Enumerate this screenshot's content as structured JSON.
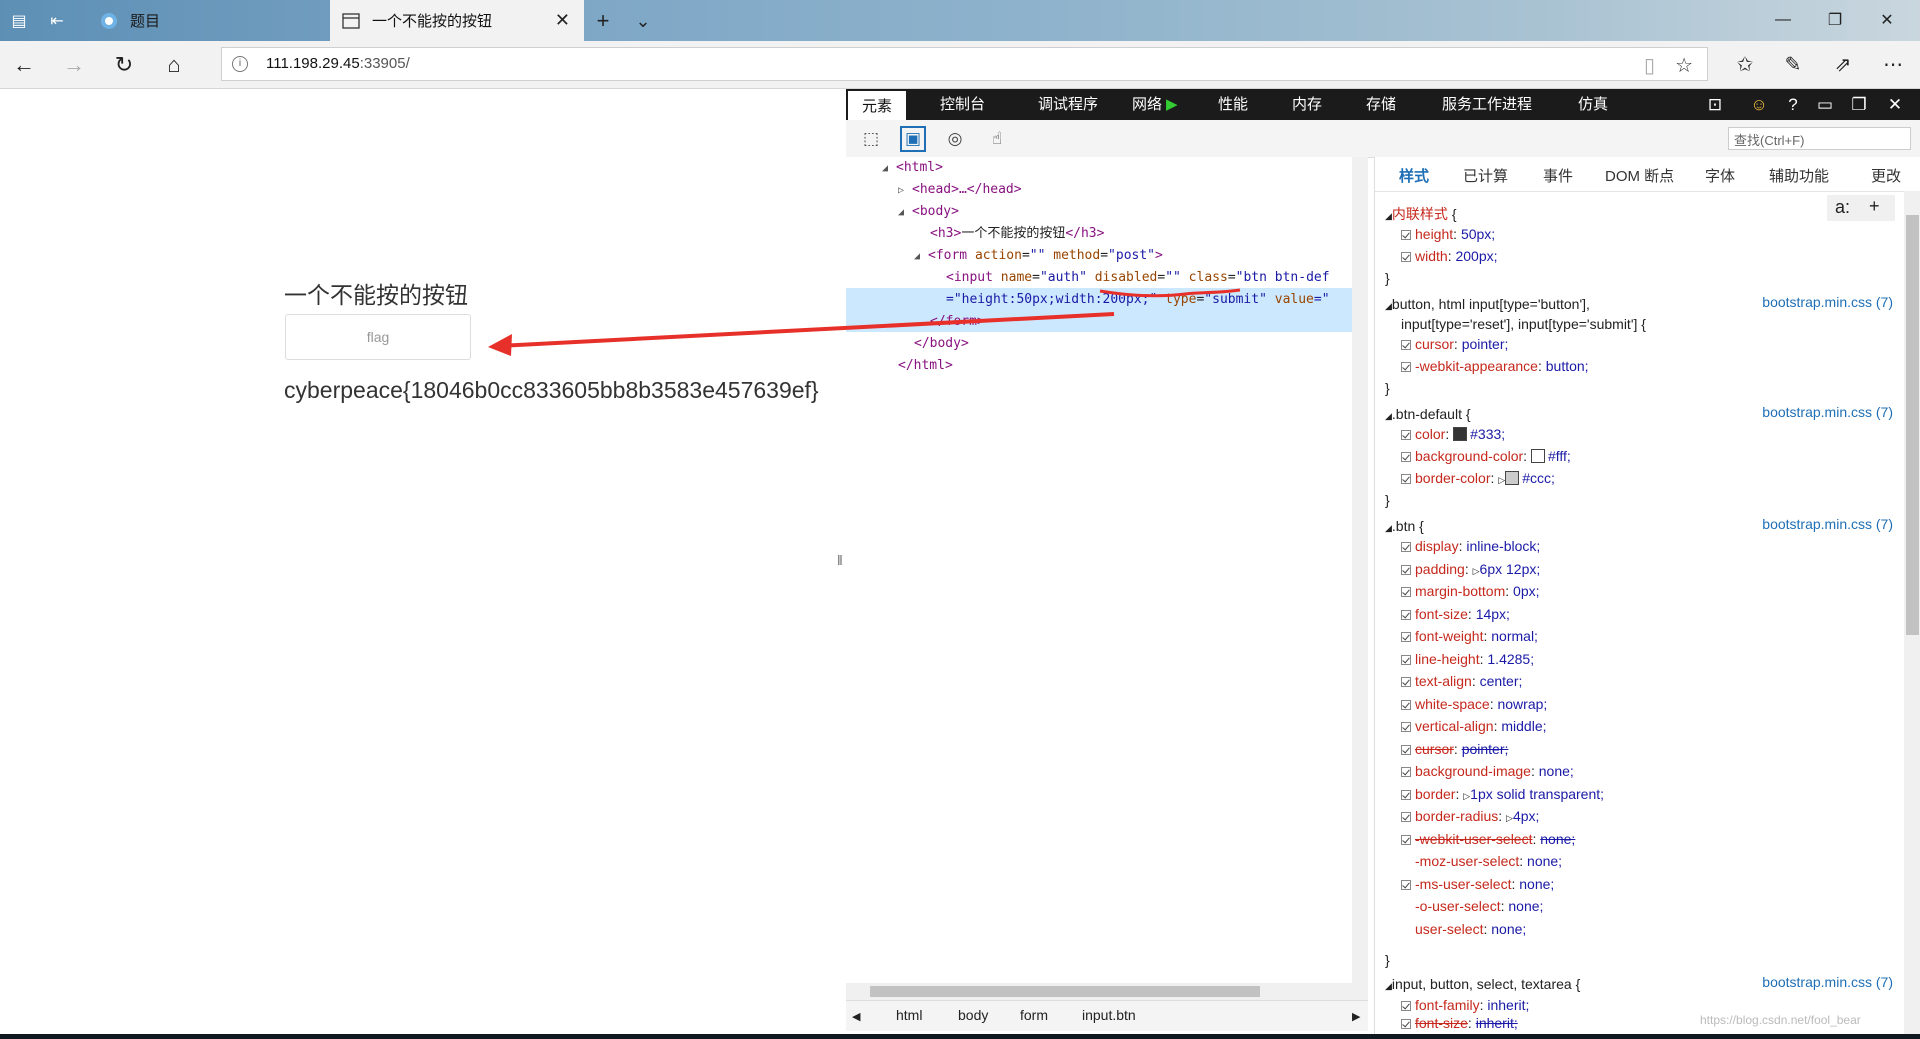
{
  "tabbar": {
    "tabs": [
      {
        "title": "题目",
        "active": false
      },
      {
        "title": "一个不能按的按钮",
        "active": true
      }
    ],
    "new_tab_glyph": "+",
    "tab_list_glyph": "⌄",
    "window_controls": [
      "—",
      "❐",
      "✕"
    ]
  },
  "addressbar": {
    "url_host": "111.198.29.45",
    "url_rest": ":33905/",
    "icons": [
      "back-icon",
      "forward-icon",
      "refresh-icon",
      "home-icon",
      "info-icon",
      "reading-view-icon",
      "favorite-star-icon",
      "favorites-icon",
      "pen-icon",
      "share-icon",
      "more-icon"
    ]
  },
  "page": {
    "heading": "一个不能按的按钮",
    "button_label": "flag",
    "flag_text": "cyberpeace{18046b0cc833605bb8b3583e457639ef}"
  },
  "devtools": {
    "tabs": [
      "元素",
      "控制台",
      "调试程序",
      "网络",
      "性能",
      "内存",
      "存储",
      "服务工作进程",
      "仿真"
    ],
    "find_placeholder": "查找(Ctrl+F)",
    "dom": {
      "html_open": "<html>",
      "head": "<head>…</head>",
      "body_open": "<body>",
      "h3_open": "<h3>",
      "h3_text": "一个不能按的按钮",
      "h3_close": "</h3>",
      "form_tag": "<form",
      "form_action_attr": "action",
      "form_action_val": "\"\"",
      "form_method_attr": "method",
      "form_method_val": "\"post\"",
      "form_end": ">",
      "input_tag": "<input",
      "input_name_attr": "name",
      "input_name_val": "\"auth\"",
      "input_disabled_attr": "disabled",
      "input_disabled_val": "\"\"",
      "input_class_attr": "class",
      "input_class_val": "\"btn btn-def",
      "input_style_val": "=\"height:50px;width:200px;\"",
      "input_type_attr": "type",
      "input_type_val": "\"submit\"",
      "input_value_attr": "value",
      "input_value_val": "=\"",
      "form_close": "</form>",
      "body_close": "</body>",
      "html_close": "</html>"
    },
    "breadcrumbs": [
      "html",
      "body",
      "form",
      "input.btn"
    ],
    "style_tabs": [
      "样式",
      "已计算",
      "事件",
      "DOM 断点",
      "字体",
      "辅助功能",
      "更改"
    ],
    "styles": {
      "pseudo_btn": "a:",
      "add_btn": "+",
      "inline_header": "内联样式",
      "inline_props": [
        [
          "height",
          "50px;"
        ],
        [
          "width",
          "200px;"
        ]
      ],
      "rule1_sel1": "button, html input[type='button'],",
      "rule1_sel2": "input[type='reset'], input[type='submit']",
      "rule1_src": "bootstrap.min.css (7)",
      "rule1_props": [
        [
          "cursor",
          "pointer;"
        ],
        [
          "-webkit-appearance",
          "button;"
        ]
      ],
      "rule2_sel": ".btn-default",
      "rule2_src": "bootstrap.min.css (7)",
      "rule2_props": [
        [
          "color",
          "#333;"
        ],
        [
          "background-color",
          "#fff;"
        ],
        [
          "border-color",
          "#ccc;"
        ]
      ],
      "rule3_sel": ".btn",
      "rule3_src": "bootstrap.min.css (7)",
      "rule3_props": [
        [
          "display",
          "inline-block;"
        ],
        [
          "padding",
          "6px 12px;"
        ],
        [
          "margin-bottom",
          "0px;"
        ],
        [
          "font-size",
          "14px;"
        ],
        [
          "font-weight",
          "normal;"
        ],
        [
          "line-height",
          "1.4285;"
        ],
        [
          "text-align",
          "center;"
        ],
        [
          "white-space",
          "nowrap;"
        ],
        [
          "vertical-align",
          "middle;"
        ],
        [
          "cursor",
          "pointer;"
        ],
        [
          "background-image",
          "none;"
        ],
        [
          "border",
          "1px solid transparent;"
        ],
        [
          "border-radius",
          "4px;"
        ],
        [
          "-webkit-user-select",
          "none;"
        ],
        [
          "-moz-user-select",
          "none;"
        ],
        [
          "-ms-user-select",
          "none;"
        ],
        [
          "-o-user-select",
          "none;"
        ],
        [
          "user-select",
          "none;"
        ]
      ],
      "rule4_sel": "input, button, select, textarea",
      "rule4_src": "bootstrap.min.css (7)",
      "rule4_props": [
        [
          "font-family",
          "inherit;"
        ],
        [
          "font-size",
          "inherit;"
        ]
      ],
      "open_brace": "{",
      "close_brace": "}"
    },
    "colors": {
      "color_333": "#333333",
      "color_fff": "#ffffff",
      "color_ccc": "#cccccc"
    }
  },
  "annotations": {
    "arrow_color": "#e8302a",
    "underline_color": "#e8302a"
  },
  "watermark": "https://blog.csdn.net/fool_bear"
}
